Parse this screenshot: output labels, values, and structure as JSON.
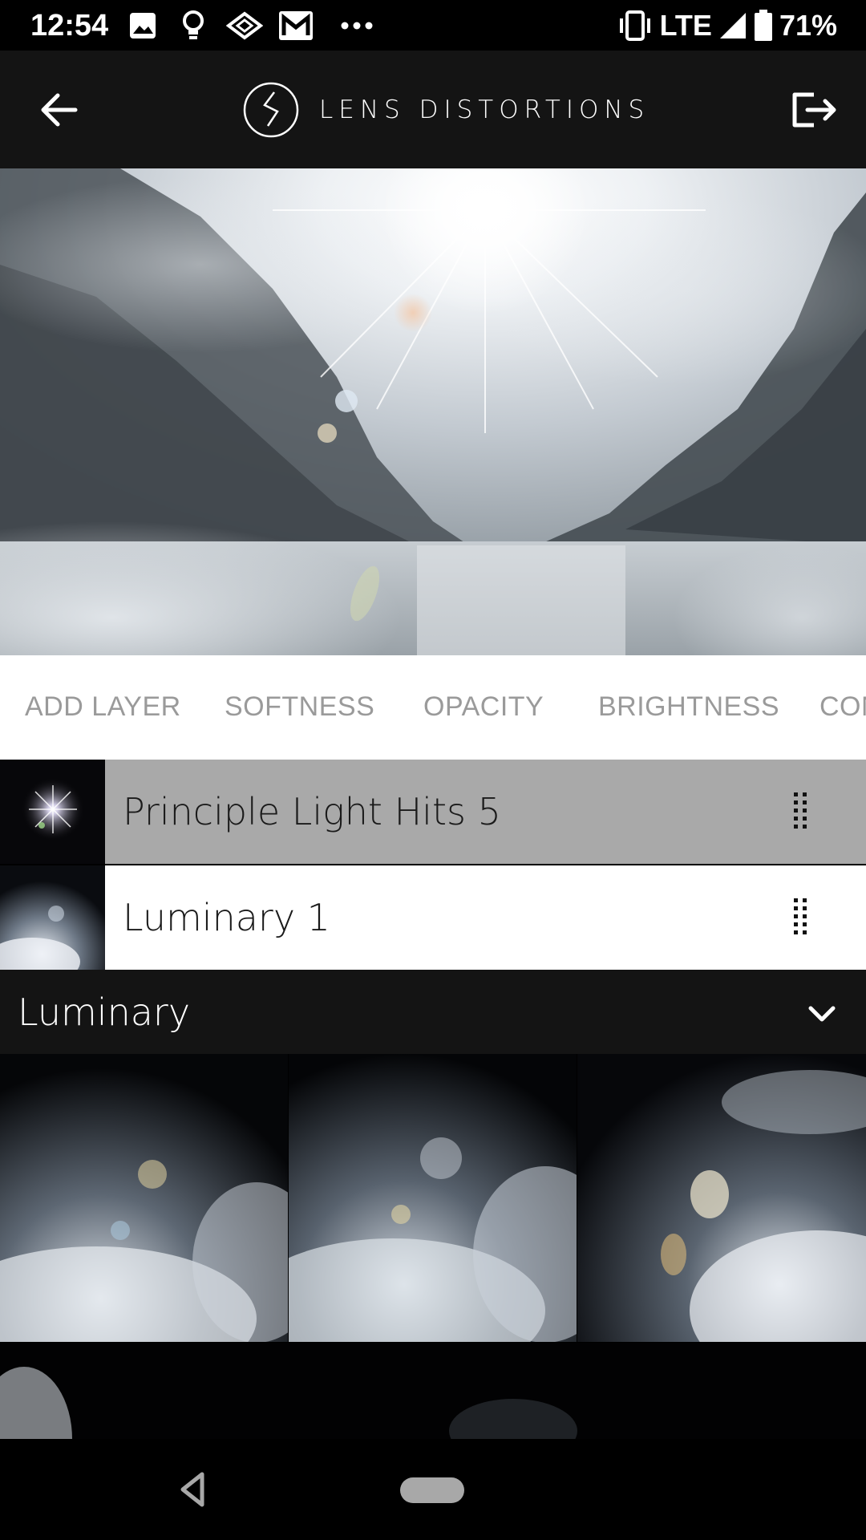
{
  "status_bar": {
    "time": "12:54",
    "network": "LTE",
    "battery": "71%",
    "icons": [
      "image-icon",
      "bulb-icon",
      "cast-diamond-icon",
      "gmail-icon",
      "more-dots-icon",
      "vibrate-icon",
      "signal-icon",
      "battery-icon"
    ]
  },
  "app_bar": {
    "title": "LENS DISTORTIONS",
    "back_icon": "arrow-left-icon",
    "share_icon": "export-icon"
  },
  "toolbar": {
    "items": [
      "ADD LAYER",
      "SOFTNESS",
      "OPACITY",
      "BRIGHTNESS",
      "CON"
    ]
  },
  "layers": [
    {
      "name": "Principle Light Hits 5",
      "selected": true
    },
    {
      "name": "Luminary 1",
      "selected": false
    }
  ],
  "category": {
    "label": "Luminary",
    "icon": "chevron-down-icon"
  },
  "colors": {
    "app_bar": "#141414",
    "selected_row": "#a9a9a9",
    "toolbar_text": "#9a9a9a"
  }
}
